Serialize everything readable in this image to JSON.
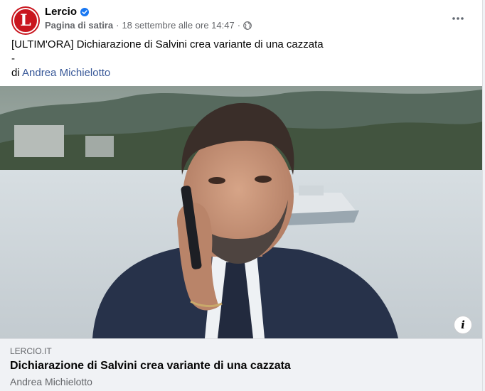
{
  "post": {
    "page_name": "Lercio",
    "avatar_letter": "L",
    "category": "Pagina di satira",
    "timestamp": "18 settembre alle ore 14:47",
    "separator": "·",
    "icons": {
      "verified": "verified-badge-icon",
      "audience": "globe-icon",
      "more": "more-options-icon",
      "info": "info-icon"
    },
    "body": {
      "line1": "[ULTIM'ORA] Dichiarazione di Salvini crea variante di una cazzata",
      "line2": "-",
      "line3_prefix": "di",
      "author": "Andrea Michielotto"
    },
    "image": {
      "info_label": "i"
    },
    "link_preview": {
      "domain": "LERCIO.IT",
      "title": "Dichiarazione di Salvini crea variante di una cazzata",
      "description": "Andrea Michielotto"
    }
  },
  "colors": {
    "brand_red": "#c9151e",
    "verified_blue": "#1877f2",
    "link_blue": "#385898",
    "secondary_text": "#65676b"
  }
}
